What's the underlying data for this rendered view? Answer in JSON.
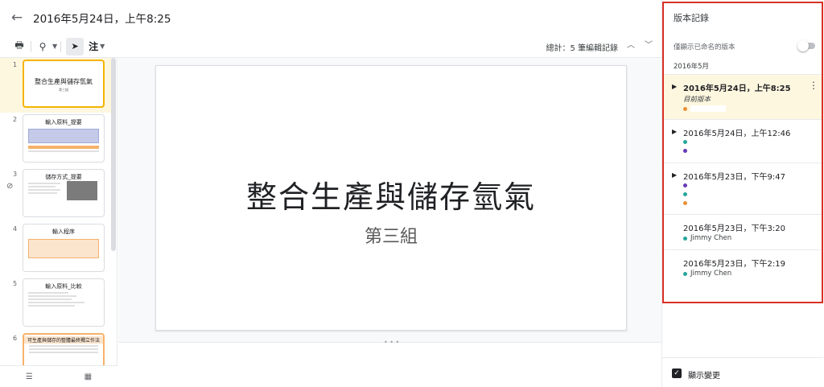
{
  "header": {
    "back_icon": "arrow-left-icon",
    "title": "2016年5月24日，上午8:25"
  },
  "toolbar": {
    "print_icon": "printer-icon",
    "zoom_icon": "zoom-icon",
    "pointer_icon": "cursor-icon",
    "annotate_label": "注",
    "edit_count": "總計：5 筆編輯記錄"
  },
  "filmstrip": {
    "slides": [
      {
        "number": "1",
        "title": "整合生產與儲存氫氣",
        "subtitle": "第三組"
      },
      {
        "number": "2",
        "title": "輸入原料_提要"
      },
      {
        "number": "3",
        "title": "儲存方式_提要"
      },
      {
        "number": "4",
        "title": "輸入程序"
      },
      {
        "number": "5",
        "title": "輸入原料_比較"
      },
      {
        "number": "6",
        "title": "可生產與儲存的整體最終獨立作法"
      }
    ]
  },
  "slide": {
    "title": "整合生產與儲存氫氣",
    "subtitle": "第三組"
  },
  "version_history": {
    "title": "版本記錄",
    "toggle_label": "僅顯示已命名的版本",
    "month": "2016年5月",
    "entries": [
      {
        "date": "2016年5月24日，上午8:25",
        "label": "目前版本",
        "dot_colors": [
          "#e69138"
        ],
        "current": true
      },
      {
        "date": "2016年5月24日，上午12:46",
        "dot_colors": [
          "#26a69a",
          "#673ab7"
        ]
      },
      {
        "date": "2016年5月23日，下午9:47",
        "dot_colors": [
          "#673ab7",
          "#26a69a",
          "#e69138"
        ]
      },
      {
        "date": "2016年5月23日，下午3:20",
        "user": "Jimmy Chen",
        "dot_color": "#26a69a"
      },
      {
        "date": "2016年5月23日，下午2:19",
        "user": "Jimmy Chen",
        "dot_color": "#26a69a"
      }
    ],
    "show_changes_label": "顯示變更",
    "highlight_color": "#d93025"
  }
}
